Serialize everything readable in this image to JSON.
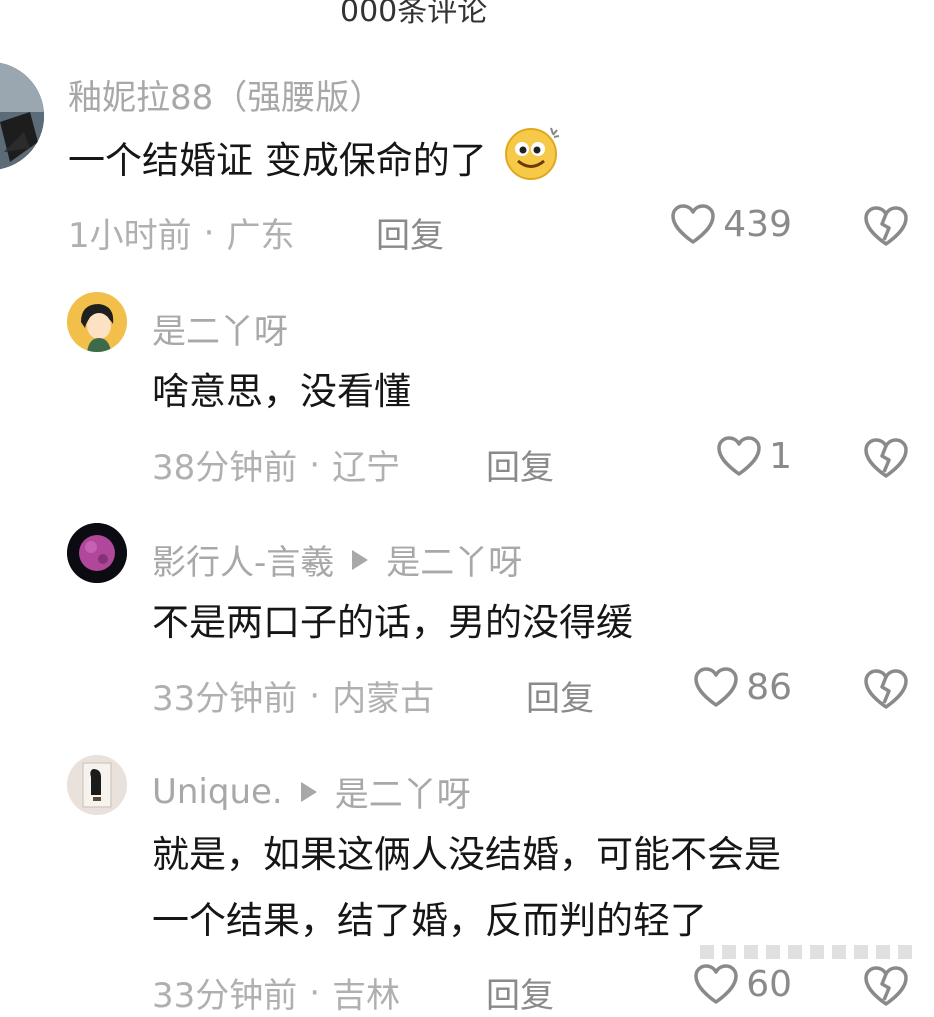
{
  "header": {
    "cut_text": "000条评论"
  },
  "comments": [
    {
      "author": "釉妮拉88（强腰版）",
      "text": "一个结婚证 变成保命的了",
      "emoji": "smiley-emoji",
      "time": "1小时前",
      "location": "广东",
      "reply_label": "回复",
      "likes": "439"
    },
    {
      "author": "是二丫呀",
      "text": "啥意思，没看懂",
      "time": "38分钟前",
      "location": "辽宁",
      "reply_label": "回复",
      "likes": "1"
    },
    {
      "author": "影行人-言羲",
      "reply_to": "是二丫呀",
      "text": "不是两口子的话，男的没得缓",
      "time": "33分钟前",
      "location": "内蒙古",
      "reply_label": "回复",
      "likes": "86"
    },
    {
      "author": "Unique.",
      "reply_to": "是二丫呀",
      "text_line1": "就是，如果这俩人没结婚，可能不会是",
      "text_line2": "一个结果，结了婚，反而判的轻了",
      "time": "33分钟前",
      "location": "吉林",
      "reply_label": "回复",
      "likes": "60"
    }
  ],
  "colors": {
    "meta": "#b0b0b0",
    "author": "#a8a8a8",
    "text": "#161616"
  },
  "icons": {
    "like": "heart-outline-icon",
    "dislike": "broken-heart-icon"
  }
}
